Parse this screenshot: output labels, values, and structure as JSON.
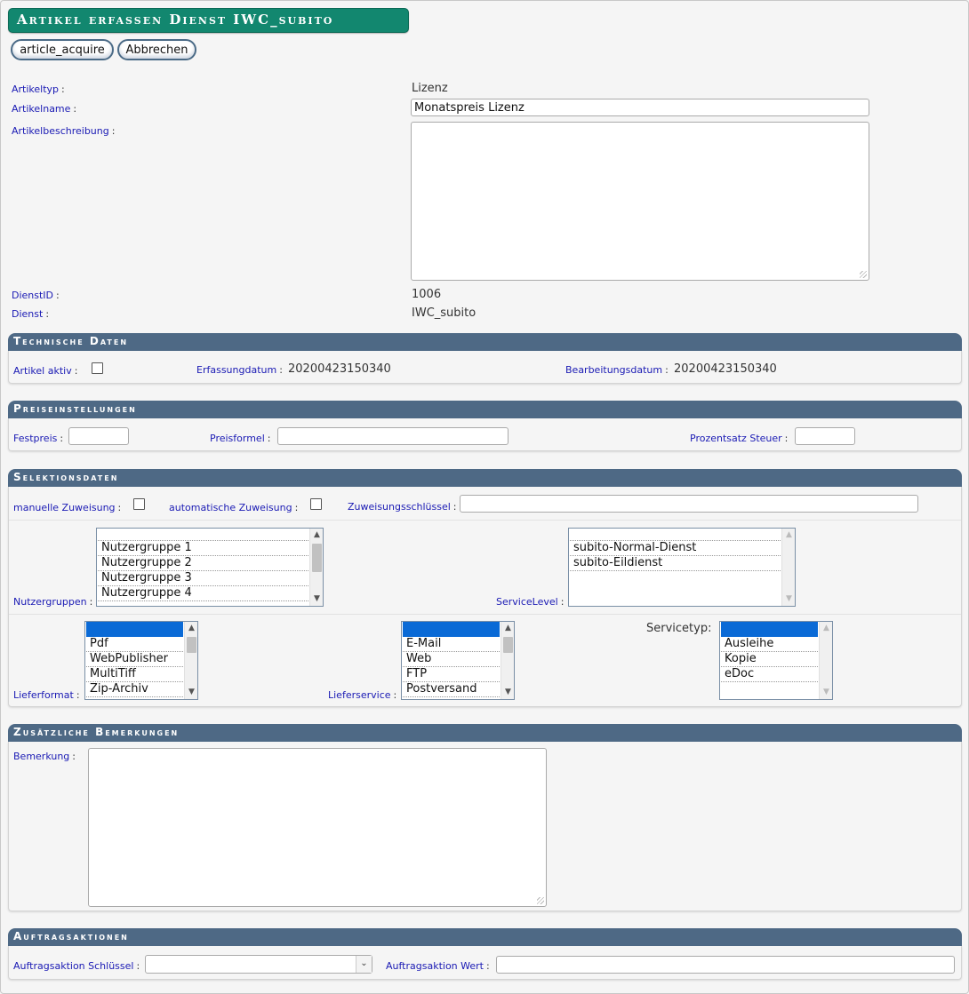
{
  "page": {
    "title": "Artikel erfassen Dienst IWC_subito",
    "buttons": {
      "acquire": "article_acquire",
      "cancel": "Abbrechen"
    }
  },
  "article": {
    "type_label": "Artikeltyp",
    "type_value": "Lizenz",
    "name_label": "Artikelname",
    "name_value": "Monatspreis Lizenz",
    "description_label": "Artikelbeschreibung",
    "description_value": "",
    "dienstid_label": "DienstID",
    "dienstid_value": "1006",
    "dienst_label": "Dienst",
    "dienst_value": "IWC_subito"
  },
  "technische_daten": {
    "header": "Technische Daten",
    "aktiv_label": "Artikel aktiv",
    "aktiv_checked": false,
    "erfassungsdatum_label": "Erfassungdatum",
    "erfassungsdatum_value": "20200423150340",
    "bearbeitungsdatum_label": "Bearbeitungsdatum",
    "bearbeitungsdatum_value": "20200423150340"
  },
  "preiseinstellungen": {
    "header": "Preiseinstellungen",
    "festpreis_label": "Festpreis",
    "festpreis_value": "",
    "preisformel_label": "Preisformel",
    "preisformel_value": "",
    "prozentsatz_label": "Prozentsatz Steuer",
    "prozentsatz_value": ""
  },
  "selektionsdaten": {
    "header": "Selektionsdaten",
    "manuell_label": "manuelle Zuweisung",
    "automatisch_label": "automatische Zuweisung",
    "schluessel_label": "Zuweisungsschlüssel",
    "schluessel_value": "",
    "nutzergruppen_label": "Nutzergruppen",
    "nutzergruppen": [
      "Nutzergruppe 1",
      "Nutzergruppe 2",
      "Nutzergruppe 3",
      "Nutzergruppe 4"
    ],
    "servicelevel_label": "ServiceLevel",
    "servicelevel": [
      "subito-Normal-Dienst",
      "subito-Eildienst"
    ],
    "lieferformat_label": "Lieferformat",
    "lieferformat": [
      "Pdf",
      "WebPublisher",
      "MultiTiff",
      "Zip-Archiv"
    ],
    "lieferservice_label": "Lieferservice",
    "lieferservice": [
      "E-Mail",
      "Web",
      "FTP",
      "Postversand"
    ],
    "servicetyp_label": "Servicetyp:",
    "servicetyp": [
      "Ausleihe",
      "Kopie",
      "eDoc"
    ]
  },
  "bemerkungen": {
    "header": "Zusätzliche Bemerkungen",
    "bemerkung_label": "Bemerkung",
    "bemerkung_value": ""
  },
  "auftragsaktionen": {
    "header": "Auftragsaktionen",
    "schluessel_label": "Auftragsaktion Schlüssel",
    "schluessel_value": "",
    "wert_label": "Auftragsaktion Wert",
    "wert_value": ""
  },
  "colors": {
    "title_bg": "#12876f",
    "section_header_bg": "#4e6985",
    "label_color": "#1a1ab4",
    "list_selection": "#0a6ad6"
  }
}
